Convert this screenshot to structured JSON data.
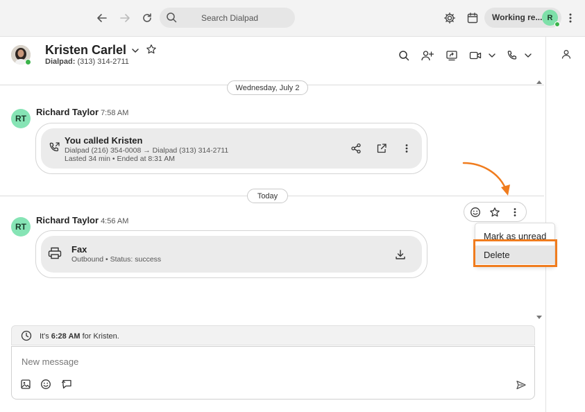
{
  "topbar": {
    "search_placeholder": "Search Dialpad",
    "status_label": "Working re...",
    "avatar_initial": "R"
  },
  "contact": {
    "name": "Kristen Carlel",
    "phone_label": "Dialpad:",
    "phone_number": "(313) 314-2711"
  },
  "conversation": {
    "date_dividers": [
      "Wednesday, July 2",
      "Today"
    ],
    "messages": [
      {
        "avatar": "RT",
        "sender": "Richard Taylor",
        "time": "7:58 AM",
        "card_title": "You called Kristen",
        "card_line1": "Dialpad (216) 354-0008 → Dialpad (313) 314-2711",
        "card_line2": "Lasted 34 min • Ended at 8:31 AM"
      },
      {
        "avatar": "RT",
        "sender": "Richard Taylor",
        "time": "4:56 AM",
        "card_title": "Fax",
        "card_line1": "Outbound • Status: success"
      }
    ]
  },
  "context_menu": {
    "items": [
      "Mark as unread",
      "Delete"
    ]
  },
  "local_time": {
    "prefix": "It's",
    "time": "6:28 AM",
    "suffix": "for Kristen."
  },
  "composer": {
    "placeholder": "New message"
  },
  "colors": {
    "highlight": "#f07c1e",
    "avatar_green": "#86e4b5",
    "presence_green": "#3bb34a"
  }
}
